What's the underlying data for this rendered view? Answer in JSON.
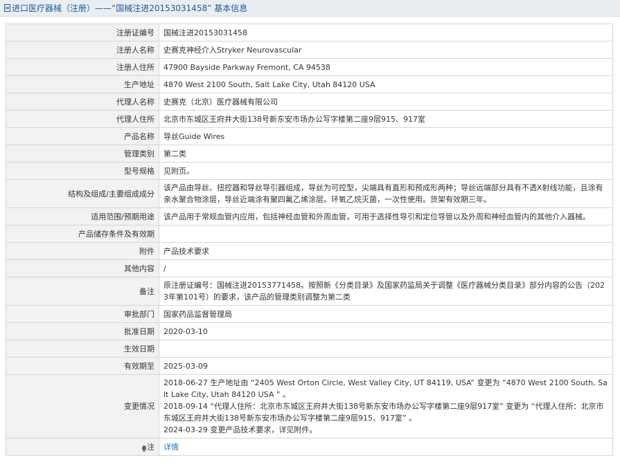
{
  "header": {
    "prefix": "进口医疗器械（注册）",
    "separator": " —— ",
    "title": "“国械注进20153031458” 基本信息"
  },
  "rows": [
    {
      "label": "注册证编号",
      "value": "国械注进20153031458"
    },
    {
      "label": "注册人名称",
      "value": "史赛克神经介入Stryker Neurovascular"
    },
    {
      "label": "注册人住所",
      "value": "47900 Bayside Parkway Fremont, CA 94538"
    },
    {
      "label": "生产地址",
      "value": "4870 West 2100 South, Salt Lake City, Utah 84120 USA"
    },
    {
      "label": "代理人名称",
      "value": "史赛克（北京）医疗器械有限公司"
    },
    {
      "label": "代理人住所",
      "value": "北京市东城区王府井大街138号新东安市场办公写字楼第二座9层915、917室"
    },
    {
      "label": "产品名称",
      "value": "导丝Guide Wires"
    },
    {
      "label": "管理类别",
      "value": "第二类"
    },
    {
      "label": "型号规格",
      "value": "见附页。"
    },
    {
      "label": "结构及组成/主要组成成分",
      "value": "该产品由导丝、扭控器和导丝导引器组成，导丝为可控型，尖端具有直形和预成形两种；导丝远端部分具有不透X射线功能，且涂有亲水聚合物涂层，导丝近端涂有聚四氟乙烯涂层。环氧乙烷灭菌，一次性使用。货架有效期三年。"
    },
    {
      "label": "适用范围/预期用途",
      "value": "该产品用于常规血管内应用，包括神经血管和外周血管，可用于选择性导引和定位导管以及外周和神经血管内的其他介入器械。"
    },
    {
      "label": "产品储存条件及有效期",
      "value": ""
    },
    {
      "label": "附件",
      "value": "产品技术要求"
    },
    {
      "label": "其他内容",
      "value": "/"
    },
    {
      "label": "备注",
      "value": "原注册证编号：国械注进20153771458。按照新《分类目录》及国家药监局关于调整《医疗器械分类目录》部分内容的公告（2023年第101号）的要求，该产品的管理类别调整为第二类"
    },
    {
      "label": "审批部门",
      "value": "国家药品监督管理局"
    },
    {
      "label": "批准日期",
      "value": "2020-03-10"
    },
    {
      "label": "生效日期",
      "value": ""
    },
    {
      "label": "有效期至",
      "value": "2025-03-09"
    }
  ],
  "change": {
    "label": "变更情况",
    "lines": [
      "2018-06-27 生产地址由 “2405 West Orton Circle, West Valley City, UT 84119, USA” 变更为 “4870 West 2100 South, Salt Lake City, Utah 84120 USA ” 。",
      "2018-09-14 “代理人住所：北京市东城区王府井大街138号新东安市场办公写字楼第二座9层917室” 变更为 “代理人住所：北京市东城区王府井大街138号新东安市场办公写字楼第二座9层915、917室” 。",
      "2024-03-29 变更产品技术要求，详见附件。"
    ]
  },
  "note": {
    "label": "注",
    "link_text": "详情"
  }
}
